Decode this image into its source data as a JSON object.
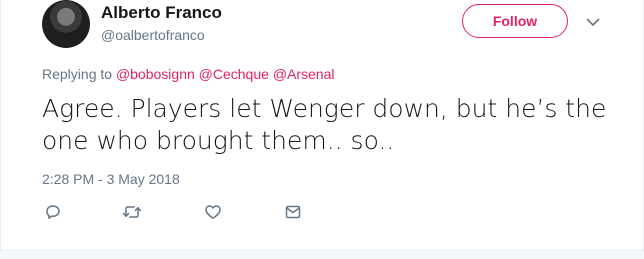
{
  "tweet": {
    "author": {
      "display_name": "Alberto Franco",
      "handle": "@oalbertofranco"
    },
    "follow_label": "Follow",
    "replying_prefix": "Replying to",
    "replying_to": [
      "@bobosignn",
      "@Cechque",
      "@Arsenal"
    ],
    "text": "Agree. Players let Wenger down, but he’s the one who brought them.. so..",
    "timestamp": "2:28 PM - 3 May 2018"
  },
  "colors": {
    "accent": "#e0245e",
    "muted": "#657786",
    "text": "#14171a"
  },
  "icons": {
    "more": "chevron-down-icon",
    "reply": "reply-icon",
    "retweet": "retweet-icon",
    "like": "heart-icon",
    "message": "envelope-icon"
  }
}
